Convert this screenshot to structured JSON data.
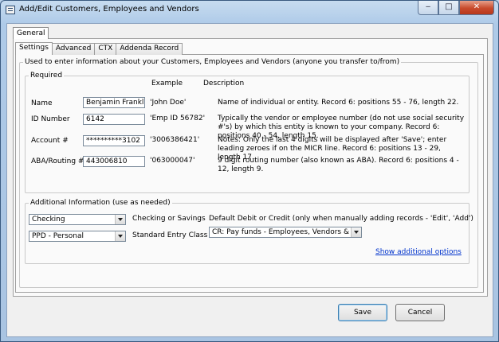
{
  "window": {
    "title": "Add/Edit Customers, Employees and Vendors"
  },
  "caption_buttons": {
    "minimize": "‒",
    "maximize": "□",
    "close": "✕"
  },
  "outer_tab": {
    "label": "General"
  },
  "inner_tabs": [
    {
      "label": "Settings",
      "active": true
    },
    {
      "label": "Advanced",
      "active": false
    },
    {
      "label": "CTX",
      "active": false
    },
    {
      "label": "Addenda Record",
      "active": false
    }
  ],
  "info_group": {
    "legend": "Used to enter information about your Customers, Employees and Vendors (anyone you transfer to/from)"
  },
  "required": {
    "legend": "Required",
    "col_example": "Example",
    "col_description": "Description",
    "fields": [
      {
        "label": "Name",
        "value": "Benjamin Franklin",
        "example": "'John Doe'",
        "description": "Name of individual or entity. Record 6: positions 55 - 76, length 22."
      },
      {
        "label": "ID Number",
        "value": "6142",
        "example": "'Emp ID 56782'",
        "description": "Typically the vendor or employee number (do not use social security #'s) by which this entity is known to your company. Record 6: positions 40 - 54, length 15."
      },
      {
        "label": "Account #",
        "value": "**********3102",
        "example": "'3006386421'",
        "description": "Notes: Only the last 4 digits will be displayed after 'Save'; enter leading zeroes if on the MICR line. Record 6: positions 13 - 29, length 17."
      },
      {
        "label": "ABA/Routing #",
        "value": "443006810",
        "example": "'063000047'",
        "description": "9 digit routing number (also known as ABA). Record 6: positions 4 - 12, length 9."
      }
    ]
  },
  "additional": {
    "legend": "Additional Information (use as needed)",
    "account_type": {
      "value": "Checking",
      "label": "Checking or Savings"
    },
    "entry_class": {
      "value": "PPD - Personal",
      "label": "Standard Entry Class"
    },
    "default_dc": {
      "label": "Default Debit or Credit (only when manually adding records - 'Edit', 'Add')",
      "value": "CR: Pay funds - Employees, Vendors & Taxes"
    },
    "show_more_link": "Show additional options"
  },
  "footer": {
    "save": "Save",
    "cancel": "Cancel"
  }
}
